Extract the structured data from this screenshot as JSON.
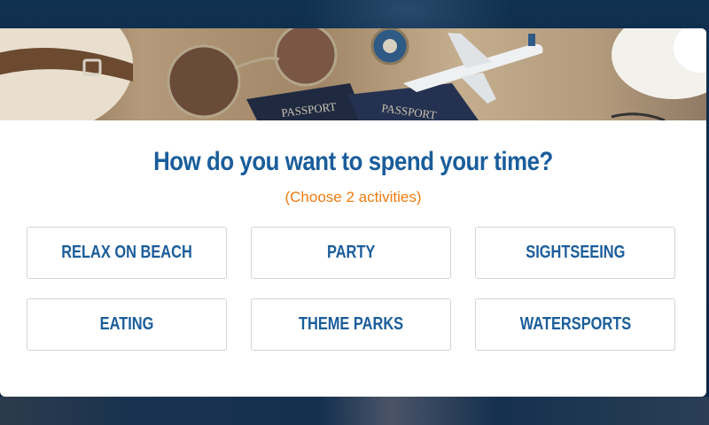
{
  "modal": {
    "hero_image": {
      "description_icon": "travel-flatlay-image",
      "passport_text": "PASSPORT"
    },
    "title": "How do you want to spend your time?",
    "subtitle": "(Choose 2 activities)",
    "activities": [
      {
        "label": "RELAX ON BEACH"
      },
      {
        "label": "PARTY"
      },
      {
        "label": "SIGHTSEEING"
      },
      {
        "label": "EATING"
      },
      {
        "label": "THEME PARKS"
      },
      {
        "label": "WATERSPORTS"
      }
    ]
  },
  "colors": {
    "title": "#1a5d9b",
    "subtitle": "#f07b12",
    "button_text": "#1a5d9b",
    "button_border": "#cfd5dc",
    "background": "#0e2a4a"
  }
}
